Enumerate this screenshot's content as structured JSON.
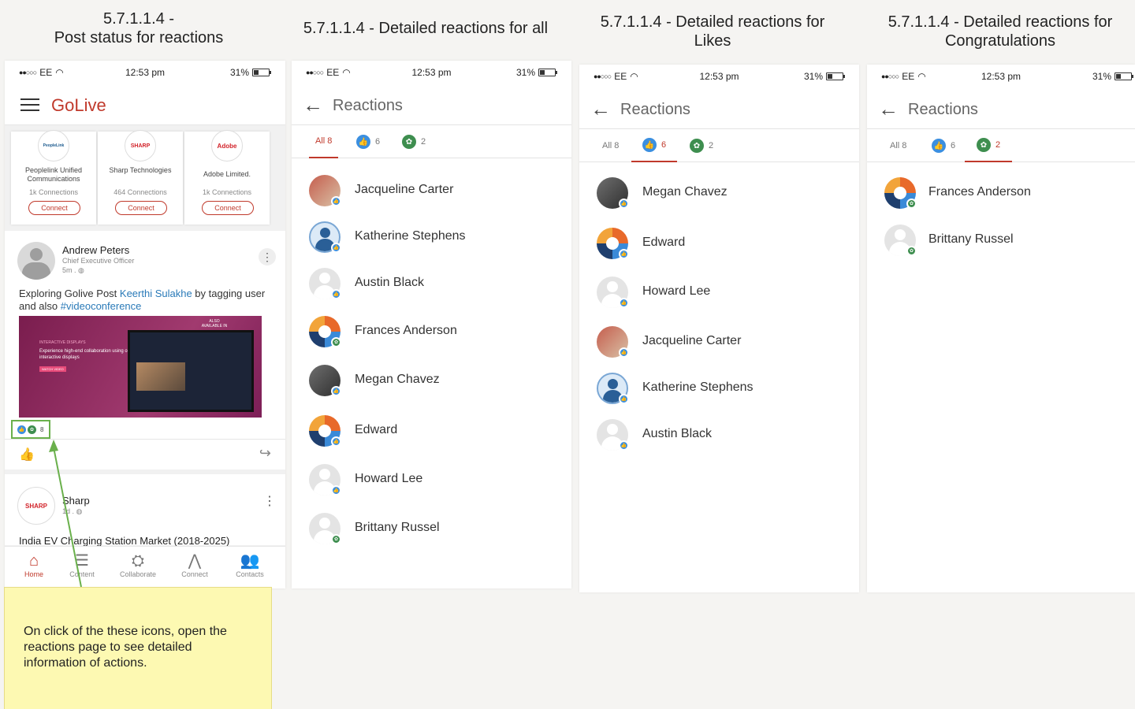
{
  "titles": {
    "p1_line1": "5.7.1.1.4 -",
    "p1_line2": "Post status for reactions",
    "p2": "5.7.1.1.4 - Detailed reactions for all",
    "p3_line1": "5.7.1.1.4 - Detailed reactions for",
    "p3_line2": "Likes",
    "p4_line1": "5.7.1.1.4 - Detailed reactions for",
    "p4_line2": "Congratulations"
  },
  "status_bar": {
    "carrier": "EE",
    "time": "12:53 pm",
    "battery": "31%"
  },
  "feed": {
    "app_name": "GoLive",
    "orgs": [
      {
        "logo": "PeopleLink",
        "name": "Peoplelink Unified Communications",
        "connections": "1k Connections",
        "button": "Connect"
      },
      {
        "logo": "SHARP",
        "name": "Sharp Technologies",
        "connections": "464 Connections",
        "button": "Connect"
      },
      {
        "logo": "Adobe",
        "name": "Adobe Limited.",
        "connections": "1k Connections",
        "button": "Connect"
      }
    ],
    "post": {
      "author": "Andrew Peters",
      "role": "Chief Executive Officer",
      "time": "5m .",
      "text_before": "Exploring Golive Post ",
      "mention": "Keerthi Sulakhe",
      "text_middle": " by tagging user and also ",
      "hashtag": "#videoconference",
      "image_small": "ALSO AVAILABLE IN",
      "image_tag": "INTERACTIVE DISPLAYS",
      "image_headline": "Experience high-end collaboration using our interactive displays",
      "image_button": "WATCH VIDEO",
      "reaction_count": "8"
    },
    "post2": {
      "author": "Sharp",
      "logo": "SHARP",
      "time": "1d .",
      "text": "India EV Charging Station Market (2018-2025)"
    },
    "nav": [
      "Home",
      "Content",
      "Collaborate",
      "Connect",
      "Contacts"
    ]
  },
  "reactions_header": "Reactions",
  "tabs": {
    "all": "All 8",
    "likes": "6",
    "congrats": "2"
  },
  "all_list": [
    "Jacqueline Carter",
    "Katherine Stephens",
    "Austin Black",
    "Frances Anderson",
    "Megan Chavez",
    "Edward",
    "Howard Lee",
    "Brittany Russel"
  ],
  "likes_list": [
    "Megan Chavez",
    "Edward",
    "Howard Lee",
    "Jacqueline Carter",
    "Katherine Stephens",
    "Austin Black"
  ],
  "congrats_list": [
    "Frances Anderson",
    "Brittany Russel"
  ],
  "note": "On click of the these icons, open the reactions page to see detailed information of actions.",
  "colors": {
    "accent": "#c0392b",
    "like": "#3b8fe0",
    "congrats": "#3e8e4f",
    "note": "#fdf9b2",
    "link": "#2a7ab8"
  }
}
